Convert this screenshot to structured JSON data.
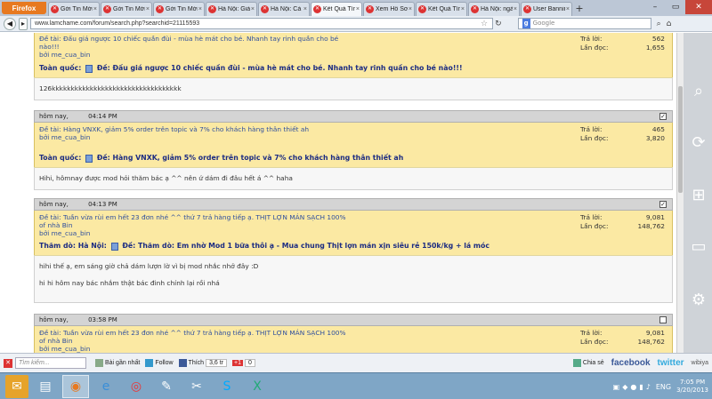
{
  "browser": {
    "app_button": "Firefox",
    "tabs": [
      {
        "label": "Gởi Tin Mới -",
        "active": false
      },
      {
        "label": "Gởi Tin Mới -",
        "active": false
      },
      {
        "label": "Gởi Tin Mới -",
        "active": false
      },
      {
        "label": "Hà Nội: Giảm",
        "active": false
      },
      {
        "label": "Hà Nội: Cá T",
        "active": false
      },
      {
        "label": "Kết Quả Tìm",
        "active": true
      },
      {
        "label": "Xem Hồ Sơ:",
        "active": false
      },
      {
        "label": "Kết Quả Tìm",
        "active": false
      },
      {
        "label": "Hà Nội: ngày",
        "active": false
      },
      {
        "label": "User Banning",
        "active": false
      }
    ],
    "url": "www.lamchame.com/forum/search.php?searchid=21115593",
    "search_engine": "Google",
    "search_placeholder": "Google"
  },
  "posts": [
    {
      "partial": true,
      "thread": "Đề tài: Đấu giá ngược 10 chiếc quần đùi - mùa hè mát cho bé. Nhanh tay rinh quần cho bé nào!!!",
      "author": "bởi me_cua_bin",
      "replies_label": "Trả lời:",
      "replies": "562",
      "views_label": "Lần đọc:",
      "views": "1,655",
      "prefix": "Toàn quốc:",
      "title": "Đề: Đấu giá ngược 10 chiếc quần đùi - mùa hè mát cho bé. Nhanh tay rinh quần cho bé nào!!!",
      "excerpt": [
        "126kkkkkkkkkkkkkkkkkkkkkkkkkkkkkkkkkk"
      ]
    },
    {
      "date": "hôm nay,",
      "time": "04:14 PM",
      "checked": true,
      "thread": "Đề tài: Hàng VNXK, giảm 5% order trên topic và 7% cho khách hàng thân thiết ah",
      "author": "bởi me_cua_bin",
      "replies_label": "Trả lời:",
      "replies": "465",
      "views_label": "Lần đọc:",
      "views": "3,820",
      "prefix": "Toàn quốc:",
      "title": "Đề: Hàng VNXK, giảm 5% order trên topic và 7% cho khách hàng thân thiết ah",
      "excerpt": [
        "Hihi, hômnay được mod hỏi thăm bác ạ ^^ nên ứ dám đi đâu hết á ^^ haha"
      ]
    },
    {
      "date": "hôm nay,",
      "time": "04:13 PM",
      "checked": true,
      "thread": "Đề tài: Tuần vừa rùi em hết 23 đơn nhé ^^ thứ 7 trả hàng tiếp ạ. THỊT LỢN MÁN SẠCH 100% of nhà Bin",
      "author": "bởi me_cua_bin",
      "replies_label": "Trả lời:",
      "replies": "9,081",
      "views_label": "Lần đọc:",
      "views": "148,762",
      "prefix": "Thăm dò: Hà Nội:",
      "title": "Đề: Thăm dò: Em nhờ Mod 1 bữa thôi ạ - Mua chung Thịt lợn mán xịn siêu rẻ 150k/kg + lá móc",
      "excerpt": [
        "hihi thế ạ, em sáng giờ chả dám lượn lờ vì bị mod nhắc nhở đây :D",
        "hi hi hôm nay bác nhắm thật bác đinh chính lại rồi nhá"
      ]
    },
    {
      "date": "hôm nay,",
      "time": "03:58 PM",
      "checked": false,
      "thread": "Đề tài: Tuần vừa rùi em hết 23 đơn nhé ^^ thứ 7 trả hàng tiếp ạ. THỊT LỢN MÁN SẠCH 100% of nhà Bin",
      "author": "bởi me_cua_bin",
      "replies_label": "Trả lời:",
      "replies": "9,081",
      "views_label": "Lần đọc:",
      "views": "148,762"
    }
  ],
  "addonbar": {
    "search_placeholder": "Tìm kiếm...",
    "recent_posts": "Bài gần nhất",
    "follow": "Follow",
    "like": "Thích",
    "like_count": "3,6 tr",
    "gplus": "+1",
    "gplus_count": "0",
    "share": "Chia sẻ",
    "facebook": "facebook",
    "twitter": "twitter",
    "wibiya": "wibiya"
  },
  "taskbar": {
    "language": "ENG",
    "time": "7:05 PM",
    "date": "3/20/2013"
  }
}
